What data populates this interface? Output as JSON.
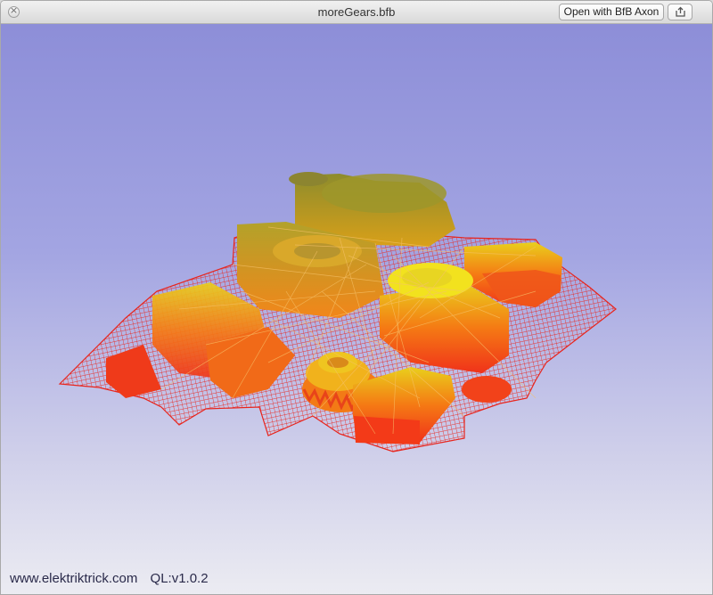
{
  "window": {
    "title": "moreGears.bfb",
    "open_button_label": "Open with BfB Axon",
    "close_glyph": "×",
    "share_icon": "share-icon"
  },
  "viewport": {
    "model_description_icon": "3d-gcode-toolpath",
    "colors": {
      "background_top": "#8d8ed8",
      "background_bottom": "#ececf2",
      "mesh_red": "#e8241c",
      "mid_orange": "#f57a14",
      "top_yellow": "#f2e21e"
    }
  },
  "footer": {
    "site": "www.elektriktrick.com",
    "version": "QL:v1.0.2"
  }
}
